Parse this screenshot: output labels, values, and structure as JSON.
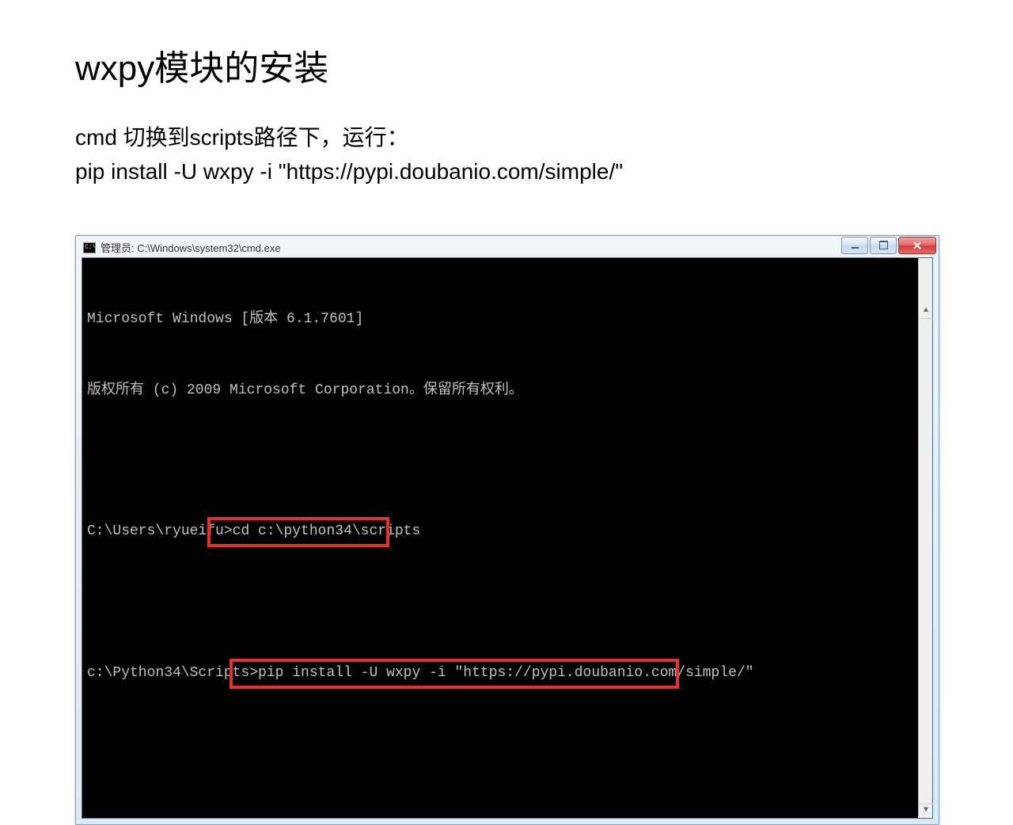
{
  "slide": {
    "title": "wxpy模块的安装",
    "instruction_line1": "cmd 切换到scripts路径下，运行：",
    "instruction_line2": "pip install -U wxpy -i \"https://pypi.doubanio.com/simple/\""
  },
  "window": {
    "title": "管理员: C:\\Windows\\system32\\cmd.exe",
    "icon_text": "C:\\"
  },
  "terminal": {
    "line1": "Microsoft Windows [版本 6.1.7601]",
    "line2": "版权所有 (c) 2009 Microsoft Corporation。保留所有权利。",
    "prompt1": "C:\\Users\\ryueifu>",
    "cmd1": "cd c:\\python34\\scripts",
    "prompt2": "c:\\Python34\\Scripts>",
    "cmd2": "pip install -U wxpy -i \"https://pypi.doubanio.com/simple/\""
  }
}
